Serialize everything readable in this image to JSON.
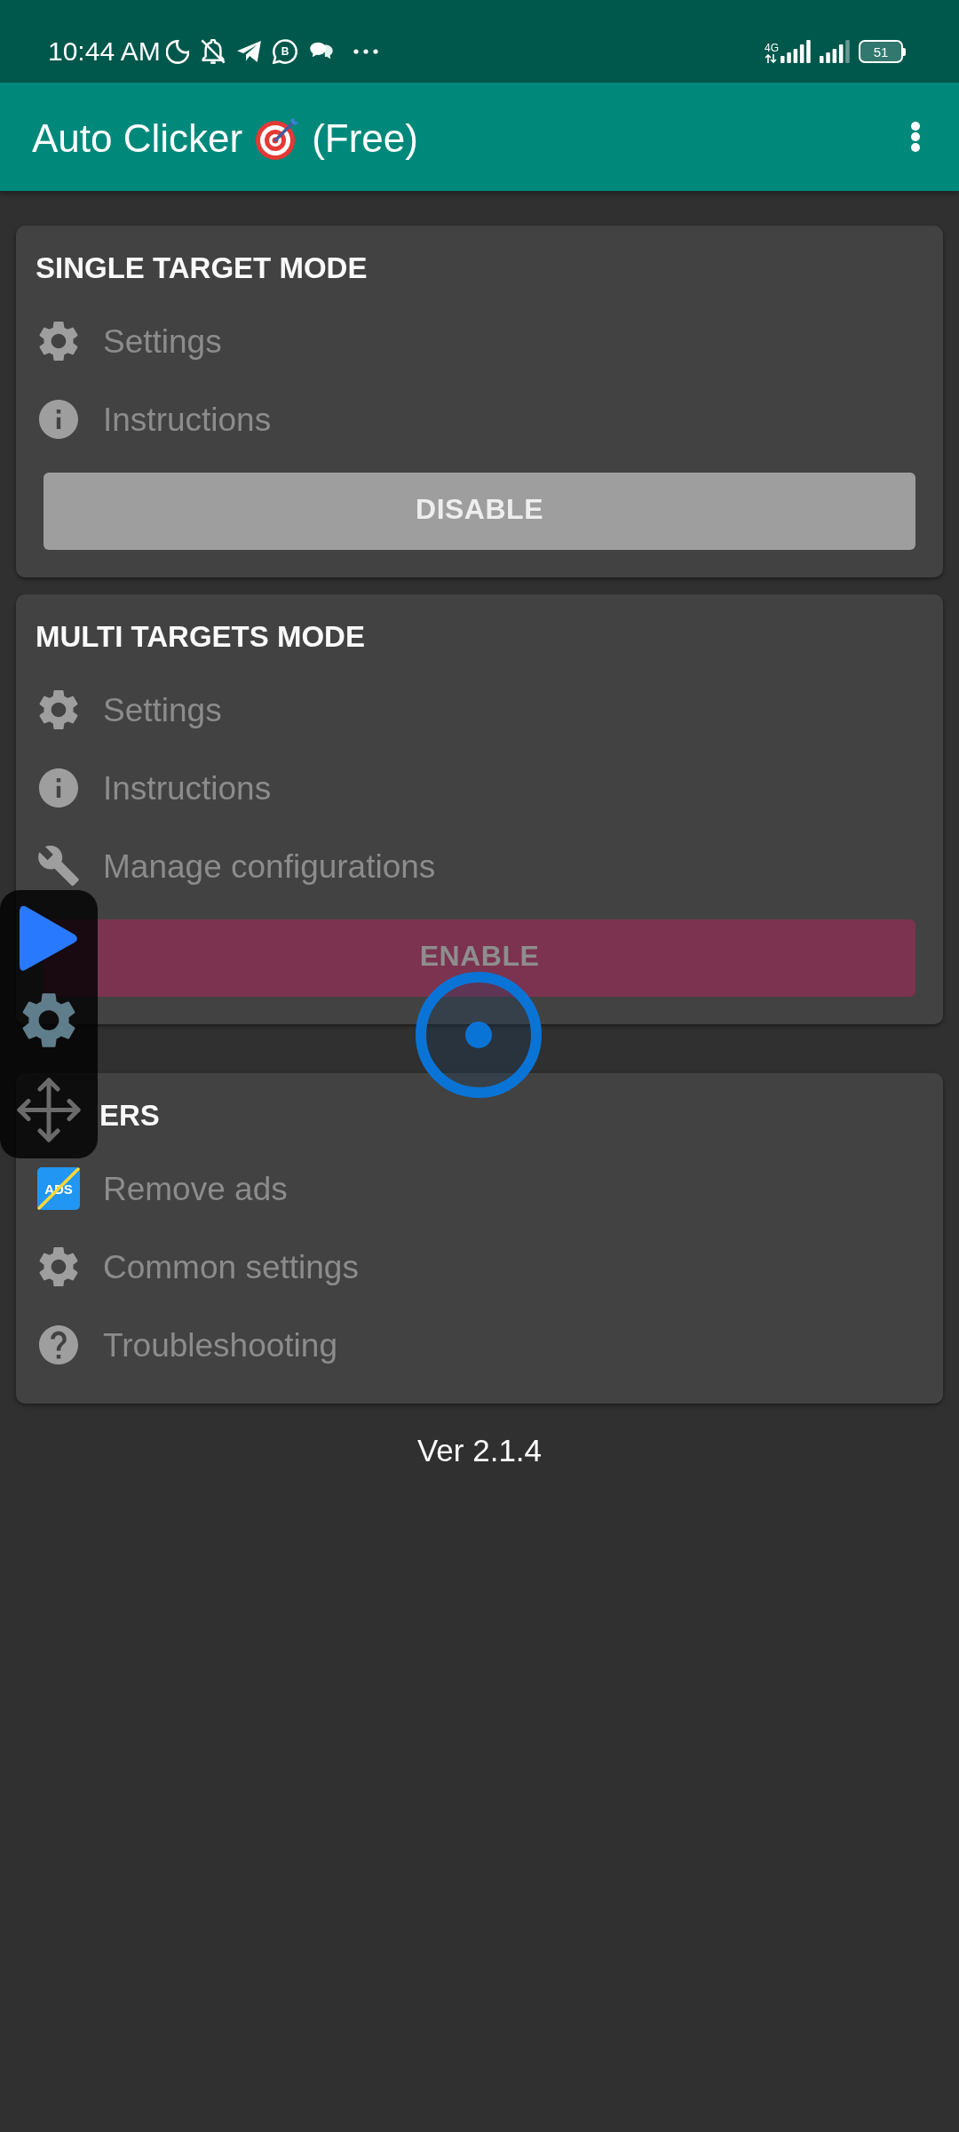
{
  "status_bar": {
    "time": "10:44 AM",
    "badge_letter": "B",
    "network": "4G",
    "battery": "51"
  },
  "app_bar": {
    "title": "Auto Clicker",
    "title_suffix": "(Free)"
  },
  "cards": [
    {
      "title": "SINGLE TARGET MODE",
      "items": [
        {
          "kind": "gear",
          "label": "Settings"
        },
        {
          "kind": "info",
          "label": "Instructions"
        }
      ],
      "button": {
        "kind": "disable",
        "label": "DISABLE",
        "disabled": false
      }
    },
    {
      "title": "MULTI TARGETS MODE",
      "items": [
        {
          "kind": "gear",
          "label": "Settings"
        },
        {
          "kind": "info",
          "label": "Instructions"
        },
        {
          "kind": "wrench",
          "label": "Manage configurations"
        }
      ],
      "button": {
        "kind": "enable",
        "label": "ENABLE",
        "disabled": true
      }
    },
    {
      "title": "ERS",
      "items": [
        {
          "kind": "ads",
          "icon_text": "ADS",
          "label": "Remove ads"
        },
        {
          "kind": "gear",
          "label": "Common settings"
        },
        {
          "kind": "help",
          "label": "Troubleshooting"
        }
      ]
    }
  ],
  "version": "Ver 2.1.4"
}
